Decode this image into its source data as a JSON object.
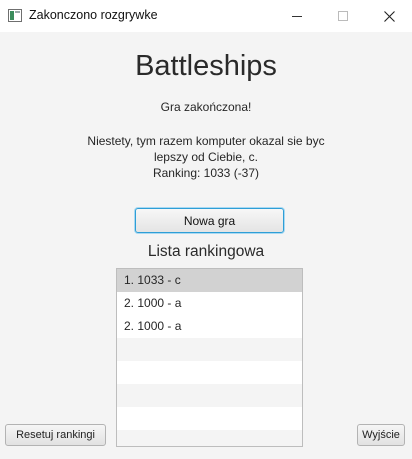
{
  "window": {
    "title": "Zakonczono rozgrywke"
  },
  "main": {
    "heading": "Battleships",
    "game_over": "Gra zakończona!",
    "message_line1": "Niestety, tym razem komputer okazal sie byc",
    "message_line2": "lepszy od Ciebie, c.",
    "ranking_change": "Ranking: 1033 (-37)",
    "new_game_label": "Nowa gra",
    "ranking_title": "Lista rankingowa"
  },
  "ranking": {
    "items": [
      "1. 1033 - c",
      "2. 1000 - a",
      "2. 1000 - a"
    ],
    "selected_index": 0
  },
  "footer": {
    "reset_label": "Resetuj rankingi",
    "exit_label": "Wyjście"
  },
  "colors": {
    "focus_border": "#2e9ed6",
    "selected_row": "#d2d2d2"
  }
}
